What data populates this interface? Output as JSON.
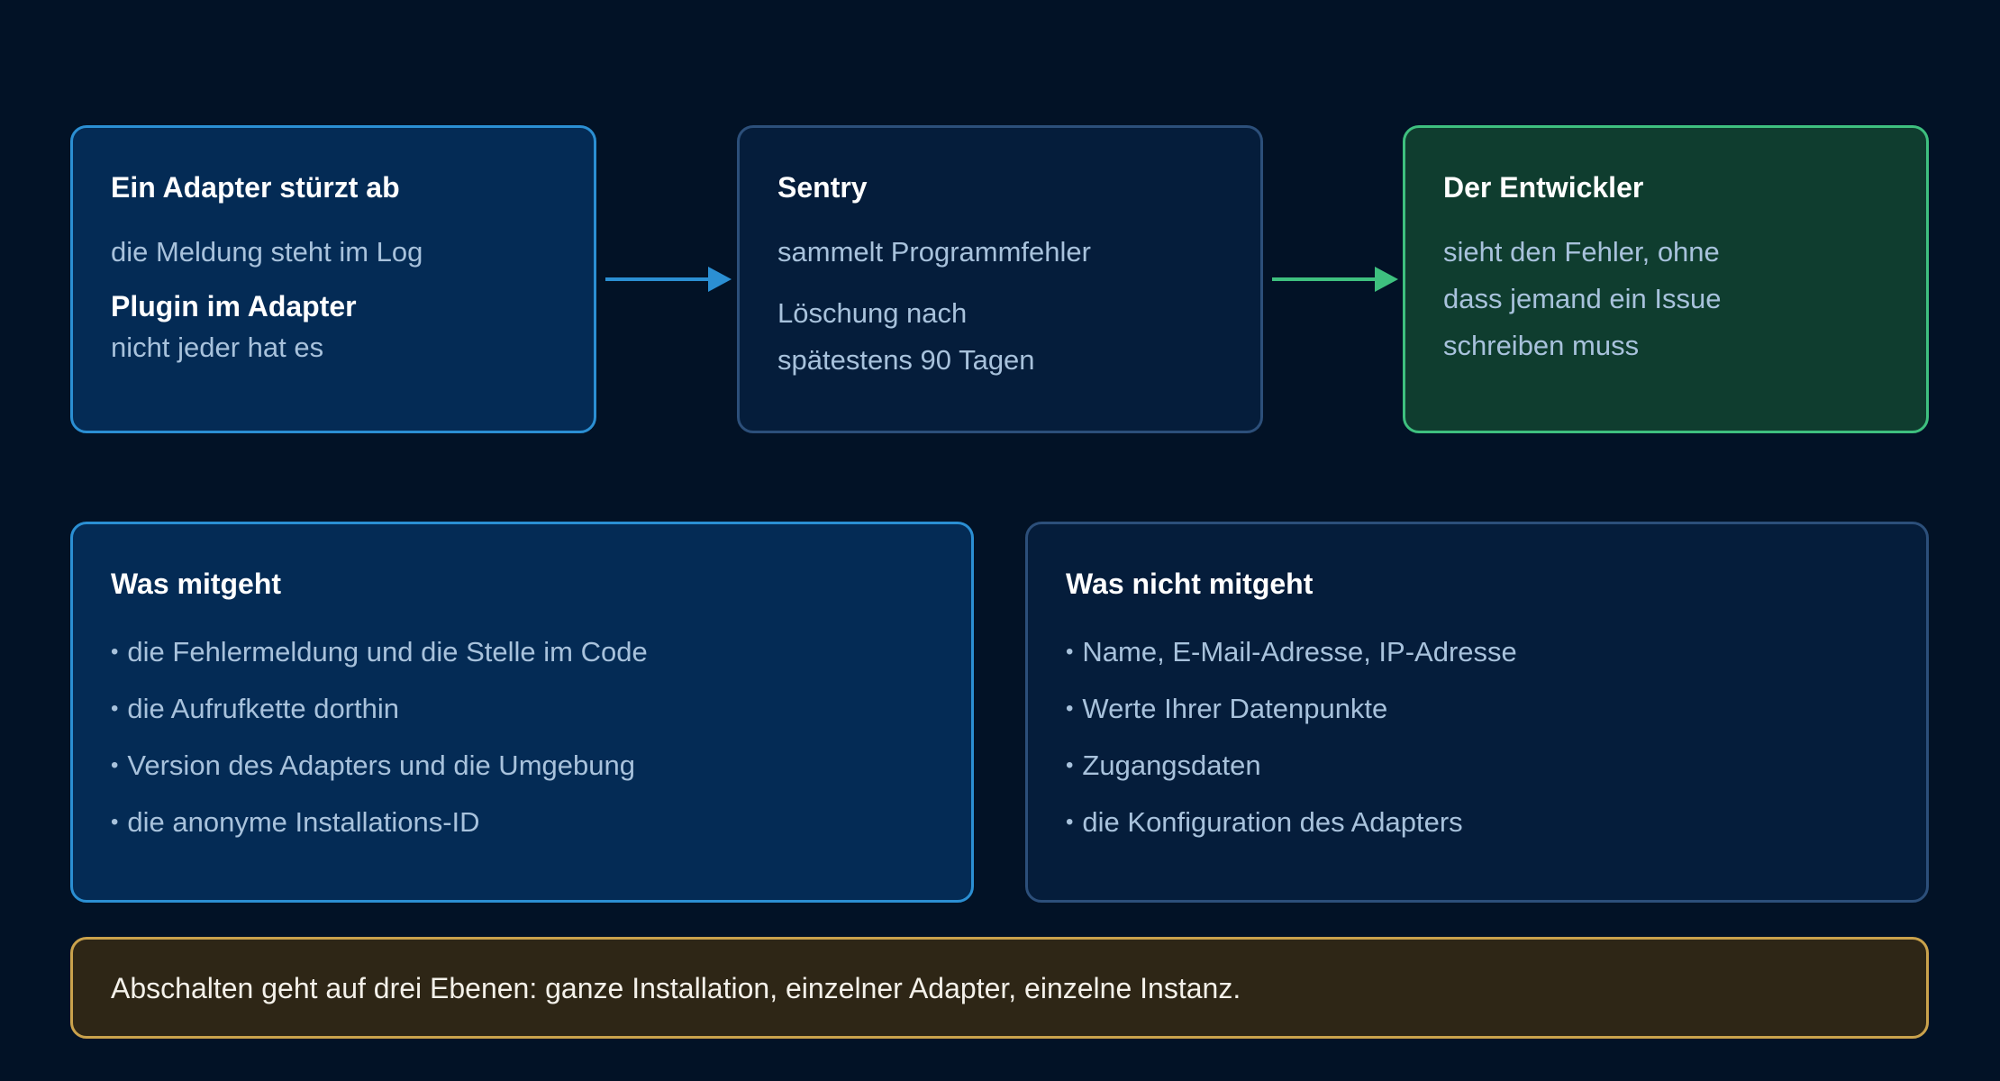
{
  "flow": {
    "step1": {
      "title": "Ein Adapter stürzt ab",
      "line": "die Meldung steht im Log",
      "subtitle": "Plugin im Adapter",
      "subline": "nicht jeder hat es"
    },
    "step2": {
      "title": "Sentry",
      "line1": "sammelt Programmfehler",
      "line2": "Löschung nach",
      "line3": "spätestens 90 Tagen"
    },
    "step3": {
      "title": "Der Entwickler",
      "line1": "sieht den Fehler, ohne",
      "line2": "dass jemand ein Issue",
      "line3": "schreiben muss"
    }
  },
  "included": {
    "title": "Was mitgeht",
    "items": [
      "die Fehlermeldung und die Stelle im Code",
      "die Aufrufkette dorthin",
      "Version des Adapters und die Umgebung",
      "die anonyme Installations-ID"
    ]
  },
  "excluded": {
    "title": "Was nicht mitgeht",
    "items": [
      "Name, E-Mail-Adresse, IP-Adresse",
      "Werte Ihrer Datenpunkte",
      "Zugangsdaten",
      "die Konfiguration des Adapters"
    ]
  },
  "notice": {
    "text": "Abschalten geht auf drei Ebenen: ganze Installation, einzelner Adapter, einzelne Instanz."
  },
  "colors": {
    "background": "#021226",
    "accent_blue": "#2b8fd3",
    "accent_green": "#3ec07f",
    "accent_gold": "#caa24c"
  }
}
